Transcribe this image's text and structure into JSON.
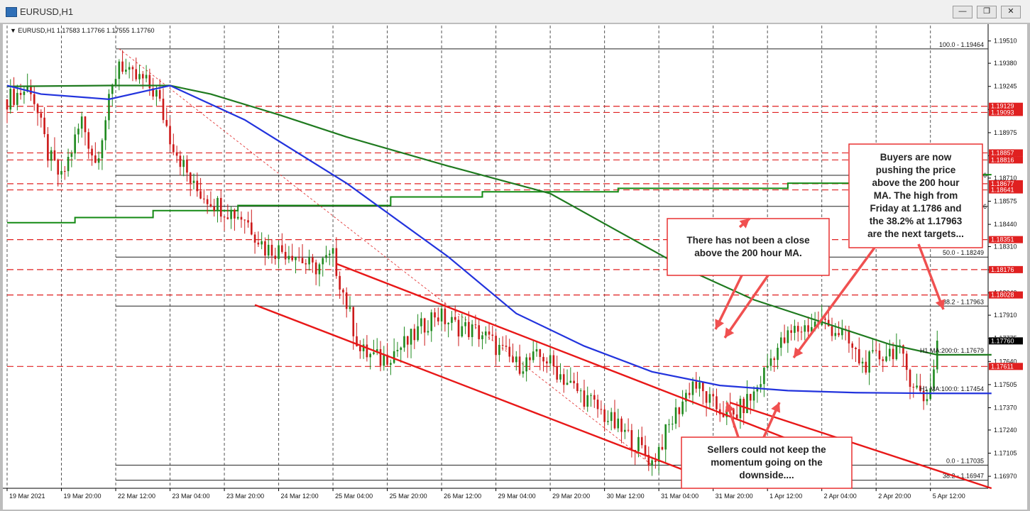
{
  "window": {
    "title": "EURUSD,H1",
    "buttons": [
      "—",
      "❐",
      "✕"
    ]
  },
  "chart_data": {
    "type": "candlestick",
    "symbol_header": "EURUSD,H1  1.17583 1.17766 1.17555 1.17760",
    "ylim": [
      1.169,
      1.196
    ],
    "y_ticks": [
      "1.19510",
      "1.19380",
      "1.19245",
      "1.19110",
      "1.18975",
      "1.18840",
      "1.18710",
      "1.18575",
      "1.18440",
      "1.18310",
      "1.18175",
      "1.18040",
      "1.17910",
      "1.17775",
      "1.17640",
      "1.17505",
      "1.17370",
      "1.17240",
      "1.17105",
      "1.16970"
    ],
    "y_tick_values": [
      1.1951,
      1.1938,
      1.19245,
      1.1911,
      1.18975,
      1.1884,
      1.1871,
      1.18575,
      1.1844,
      1.1831,
      1.18175,
      1.1804,
      1.1791,
      1.17775,
      1.1764,
      1.17505,
      1.1737,
      1.1724,
      1.17105,
      1.1697
    ],
    "x_tick_labels": [
      "19 Mar 2021",
      "19 Mar 20:00",
      "22 Mar 12:00",
      "23 Mar 04:00",
      "23 Mar 20:00",
      "24 Mar 12:00",
      "25 Mar 04:00",
      "25 Mar 20:00",
      "26 Mar 12:00",
      "29 Mar 04:00",
      "29 Mar 20:00",
      "30 Mar 12:00",
      "31 Mar 04:00",
      "31 Mar 20:00",
      "1 Apr 12:00",
      "2 Apr 04:00",
      "2 Apr 20:00",
      "5 Apr 12:00"
    ],
    "x_tick_index": [
      0,
      16,
      32,
      48,
      64,
      80,
      96,
      112,
      128,
      144,
      160,
      176,
      192,
      208,
      224,
      240,
      256,
      272
    ],
    "bar_count": 290,
    "ohlc_path": [
      [
        0,
        1.1917
      ],
      [
        7,
        1.1924
      ],
      [
        12,
        1.1885
      ],
      [
        16,
        1.187
      ],
      [
        22,
        1.1905
      ],
      [
        26,
        1.188
      ],
      [
        33,
        1.194
      ],
      [
        36,
        1.193
      ],
      [
        40,
        1.1928
      ],
      [
        44,
        1.192
      ],
      [
        48,
        1.1895
      ],
      [
        55,
        1.1865
      ],
      [
        64,
        1.1853
      ],
      [
        70,
        1.1848
      ],
      [
        76,
        1.183
      ],
      [
        84,
        1.1828
      ],
      [
        90,
        1.1818
      ],
      [
        96,
        1.1825
      ],
      [
        104,
        1.177
      ],
      [
        110,
        1.1765
      ],
      [
        118,
        1.1775
      ],
      [
        126,
        1.1792
      ],
      [
        132,
        1.1785
      ],
      [
        140,
        1.178
      ],
      [
        150,
        1.1762
      ],
      [
        158,
        1.1767
      ],
      [
        166,
        1.175
      ],
      [
        172,
        1.174
      ],
      [
        180,
        1.1725
      ],
      [
        186,
        1.1715
      ],
      [
        190,
        1.1705
      ],
      [
        196,
        1.173
      ],
      [
        202,
        1.1752
      ],
      [
        208,
        1.1738
      ],
      [
        214,
        1.1732
      ],
      [
        220,
        1.1745
      ],
      [
        226,
        1.177
      ],
      [
        232,
        1.1782
      ],
      [
        240,
        1.1787
      ],
      [
        246,
        1.178
      ],
      [
        252,
        1.1762
      ],
      [
        258,
        1.1768
      ],
      [
        262,
        1.1772
      ],
      [
        266,
        1.1755
      ],
      [
        270,
        1.1742
      ],
      [
        272,
        1.1748
      ],
      [
        274,
        1.1776
      ]
    ],
    "ma200": [
      [
        0,
        1.19245
      ],
      [
        30,
        1.1925
      ],
      [
        48,
        1.1925
      ],
      [
        60,
        1.192
      ],
      [
        80,
        1.1908
      ],
      [
        100,
        1.1895
      ],
      [
        130,
        1.1878
      ],
      [
        160,
        1.1862
      ],
      [
        180,
        1.184
      ],
      [
        200,
        1.1818
      ],
      [
        220,
        1.18
      ],
      [
        240,
        1.1787
      ],
      [
        260,
        1.1774
      ],
      [
        274,
        1.17679
      ],
      [
        290,
        1.17679
      ]
    ],
    "ma100": [
      [
        0,
        1.1925
      ],
      [
        10,
        1.192
      ],
      [
        30,
        1.1917
      ],
      [
        48,
        1.1925
      ],
      [
        70,
        1.1905
      ],
      [
        100,
        1.1868
      ],
      [
        130,
        1.1825
      ],
      [
        150,
        1.1792
      ],
      [
        170,
        1.1773
      ],
      [
        190,
        1.1758
      ],
      [
        210,
        1.175
      ],
      [
        230,
        1.1747
      ],
      [
        250,
        1.17458
      ],
      [
        274,
        1.17454
      ],
      [
        290,
        1.17454
      ]
    ],
    "step_line": [
      [
        0,
        1.1845
      ],
      [
        20,
        1.1845
      ],
      [
        20,
        1.1848
      ],
      [
        43,
        1.1848
      ],
      [
        43,
        1.1852
      ],
      [
        68,
        1.1852
      ],
      [
        68,
        1.1855
      ],
      [
        113,
        1.1855
      ],
      [
        113,
        1.186
      ],
      [
        140,
        1.186
      ],
      [
        140,
        1.1863
      ],
      [
        180,
        1.1863
      ],
      [
        180,
        1.1865
      ],
      [
        230,
        1.1865
      ],
      [
        230,
        1.1868
      ],
      [
        252,
        1.1868
      ],
      [
        252,
        1.1873
      ],
      [
        290,
        1.1873
      ]
    ],
    "fib_levels": [
      {
        "label": "100.0 - 1.19464",
        "value": 1.19464
      },
      {
        "label": "50.0 - 1.18249",
        "value": 1.18249
      },
      {
        "label": "38.2 - 1.17963",
        "value": 1.17963
      },
      {
        "label": "0.0 - 1.17035",
        "value": 1.17035
      },
      {
        "label": "38.2 - 1.16947",
        "value": 1.16947
      }
    ],
    "fib_extra": [
      {
        "value": 1.18545,
        "label": "86"
      },
      {
        "value": 1.18726,
        "label": "26"
      }
    ],
    "red_levels": [
      {
        "label": "1.19129",
        "value": 1.19129
      },
      {
        "label": "1.19093",
        "value": 1.19093
      },
      {
        "label": "1.18857",
        "value": 1.18857
      },
      {
        "label": "1.18816",
        "value": 1.18816
      },
      {
        "label": "1.18677",
        "value": 1.18677
      },
      {
        "label": "1.18641",
        "value": 1.18641
      },
      {
        "label": "1.18351",
        "value": 1.18351
      },
      {
        "label": "1.18176",
        "value": 1.18176
      },
      {
        "label": "1.18028",
        "value": 1.18028
      },
      {
        "label": "1.17611",
        "value": 1.17611
      }
    ],
    "current_price_label": "1.17760",
    "current_price": 1.1776,
    "ma_labels": [
      {
        "label": "H1 MA:200:0: 1.17679",
        "value": 1.17679
      },
      {
        "label": "H1 MA:100:0: 1.17454",
        "value": 1.17454
      }
    ],
    "channel_lines": [
      {
        "from": [
          97,
          1.1821
        ],
        "to": [
          231,
          1.1718
        ]
      },
      {
        "from": [
          73,
          1.1797
        ],
        "to": [
          212,
          1.1691
        ]
      },
      {
        "from": [
          213,
          1.174
        ],
        "to": [
          290,
          1.169
        ]
      }
    ],
    "annotations": [
      {
        "text": "There has not been a close above the 200 hour MA.",
        "lines": [
          "There has not been a close",
          "above the 200 hour MA."
        ]
      },
      {
        "text": "Buyers are now pushing the price above the 200 hour MA. The high from Friday at 1.1786 and the 38.2% at 1.17963 are the next targets...",
        "lines": [
          "Buyers are now",
          "pushing the price",
          "above the 200 hour",
          "MA. The high from",
          "Friday at 1.1786 and",
          "the 38.2% at 1.17963",
          "are the next targets..."
        ]
      },
      {
        "text": "Sellers could not keep the momentum going on the downside....",
        "lines": [
          "Sellers could not keep the",
          "momentum going on the",
          "downside...."
        ]
      }
    ],
    "colors": {
      "up": "#1f8a1f",
      "down": "#cc1a1a",
      "ma200": "#1f7a1f",
      "ma100": "#2233dd",
      "step": "#138a13",
      "level": "#e02020",
      "fib": "#222222",
      "arrow": "#f05050"
    }
  }
}
